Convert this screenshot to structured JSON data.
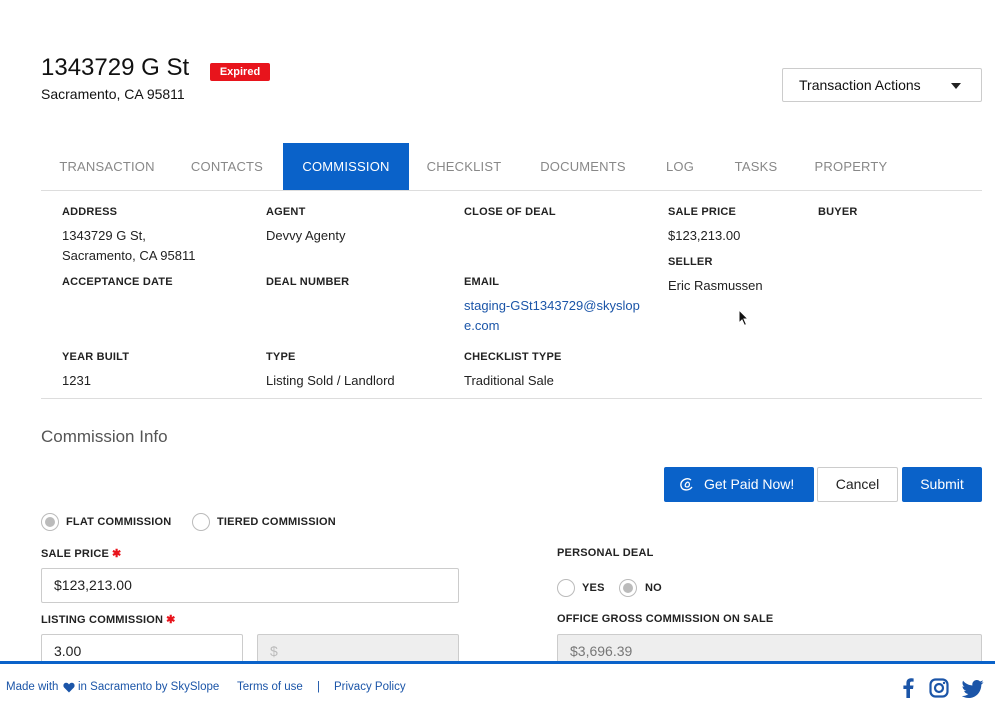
{
  "header": {
    "title": "1343729 G St",
    "status": "Expired",
    "subtitle": "Sacramento, CA 95811",
    "actions_label": "Transaction Actions"
  },
  "tabs": [
    {
      "label": "TRANSACTION"
    },
    {
      "label": "CONTACTS"
    },
    {
      "label": "COMMISSION"
    },
    {
      "label": "CHECKLIST"
    },
    {
      "label": "DOCUMENTS"
    },
    {
      "label": "LOG"
    },
    {
      "label": "TASKS"
    },
    {
      "label": "PROPERTY"
    }
  ],
  "active_tab": "COMMISSION",
  "details": {
    "address_label": "ADDRESS",
    "address_line1": "1343729 G St,",
    "address_line2": "Sacramento, CA 95811",
    "agent_label": "AGENT",
    "agent_value": "Devvy Agenty",
    "close_label": "CLOSE OF DEAL",
    "sale_price_label": "SALE PRICE",
    "sale_price_value": "$123,213.00",
    "buyer_label": "BUYER",
    "seller_label": "SELLER",
    "seller_value": "Eric Rasmussen",
    "acceptance_label": "ACCEPTANCE DATE",
    "deal_number_label": "DEAL NUMBER",
    "email_label": "EMAIL",
    "email_line1": "staging-GSt1343729@skyslop",
    "email_line2": "e.com",
    "year_built_label": "YEAR BUILT",
    "year_built_value": "1231",
    "type_label": "TYPE",
    "type_value": "Listing Sold / Landlord",
    "checklist_type_label": "CHECKLIST TYPE",
    "checklist_type_value": "Traditional Sale"
  },
  "commission": {
    "section_title": "Commission Info",
    "get_paid_label": "Get Paid Now!",
    "cancel_label": "Cancel",
    "submit_label": "Submit",
    "flat_label": "FLAT COMMISSION",
    "tiered_label": "TIERED COMMISSION",
    "sale_price_label": "SALE PRICE",
    "required_mark": "✱",
    "sale_price_value": "$123,213.00",
    "listing_commission_label": "LISTING COMMISSION",
    "listing_commission_value": "3.00",
    "listing_commission_dollar_placeholder": "$",
    "personal_deal_label": "PERSONAL DEAL",
    "yes_label": "YES",
    "no_label": "NO",
    "office_gross_label": "OFFICE GROSS COMMISSION ON SALE",
    "office_gross_value": "$3,696.39"
  },
  "footer": {
    "made_with_prefix": "Made with",
    "made_with_suffix": "in Sacramento by SkySlope",
    "terms_label": "Terms of use",
    "separator": "|",
    "privacy_label": "Privacy Policy"
  },
  "colors": {
    "accent": "#0a62c9",
    "badge": "#e8141c",
    "link": "#1b55a8"
  }
}
